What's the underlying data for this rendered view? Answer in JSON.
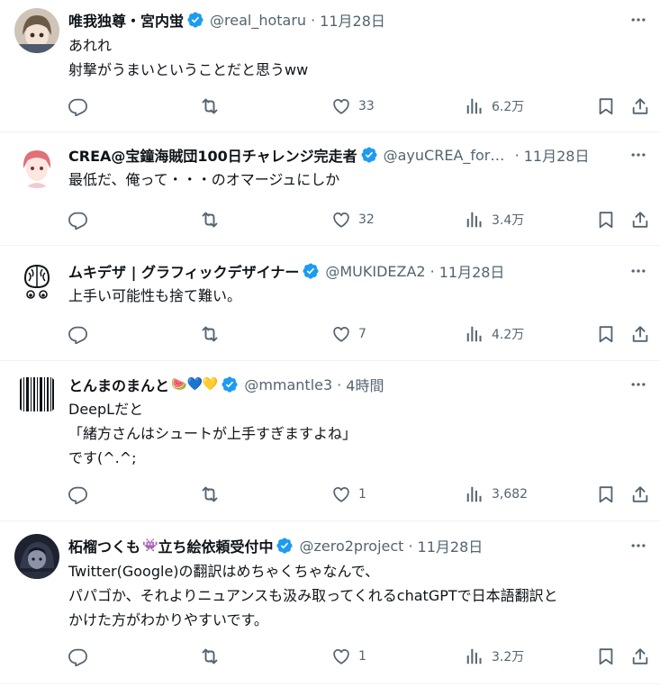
{
  "colors": {
    "verified": "#1d9bf0",
    "text": "#0f1419",
    "muted": "#536471",
    "divider": "#eff3f4"
  },
  "icons": {
    "reply": "reply-icon",
    "retweet": "retweet-icon",
    "like": "heart-icon",
    "views": "views-icon",
    "bookmark": "bookmark-icon",
    "share": "share-icon",
    "more": "more-icon",
    "verified": "verified-badge-icon"
  },
  "tweets": [
    {
      "name": "唯我独尊・宮内蛍",
      "handle": "@real_hotaru",
      "sep": "·",
      "time": "11月28日",
      "lines": [
        "あれれ",
        "射撃がうまいということだと思うww"
      ],
      "likes": "33",
      "views": "6.2万"
    },
    {
      "name": "CREA@宝鐘海賊団100日チャレンジ完走者",
      "handle": "@ayuCREA_for_VTuber",
      "sep": "·",
      "time": "11月28日",
      "lines": [
        "最低だ、俺って・・・のオマージュにしか"
      ],
      "likes": "32",
      "views": "3.4万"
    },
    {
      "name": "ムキデザ | グラフィックデザイナー",
      "handle": "@MUKIDEZA2",
      "sep": "·",
      "time": "11月28日",
      "lines": [
        "上手い可能性も捨て難い。"
      ],
      "likes": "7",
      "views": "4.2万"
    },
    {
      "name": "とんまのまんと",
      "name_emoji": "🍉💙💛",
      "handle": "@mmantle3",
      "sep": "·",
      "time": "4時間",
      "lines": [
        "DeepLだと",
        "「緒方さんはシュートが上手すぎますよね」",
        "です(^.^;"
      ],
      "likes": "1",
      "views": "3,682"
    },
    {
      "name": "柘榴つくも",
      "name_emoji": "👾",
      "name_suffix": "立ち絵依頼受付中",
      "handle": "@zero2project",
      "sep": "·",
      "time": "11月28日",
      "lines": [
        "Twitter(Google)の翻訳はめちゃくちゃなんで、",
        "パパゴか、それよりニュアンスも汲み取ってくれるchatGPTで日本語翻訳と",
        "かけた方がわかりやすいです。"
      ],
      "likes": "1",
      "views": "3.2万"
    }
  ]
}
